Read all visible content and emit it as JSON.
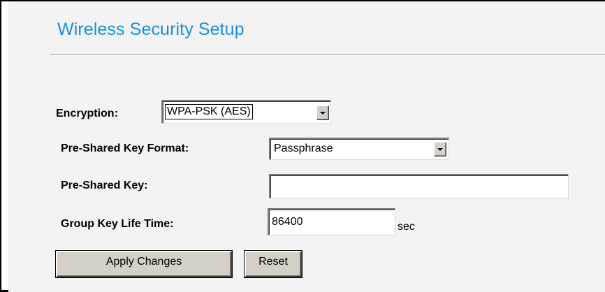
{
  "page": {
    "title": "Wireless Security Setup"
  },
  "encryption": {
    "label": "Encryption:",
    "selected": "WPA-PSK (AES)"
  },
  "psk_format": {
    "label": "Pre-Shared Key Format:",
    "selected": "Passphrase"
  },
  "psk": {
    "label": "Pre-Shared Key:",
    "value": ""
  },
  "group_key_life_time": {
    "label": "Group Key Life Time:",
    "value": "86400",
    "unit": "sec"
  },
  "actions": {
    "apply_label": "Apply Changes",
    "reset_label": "Reset"
  },
  "colors": {
    "title": "#1a8fe0",
    "background": "#f3f3f3",
    "button_face": "#d4d0c8"
  }
}
